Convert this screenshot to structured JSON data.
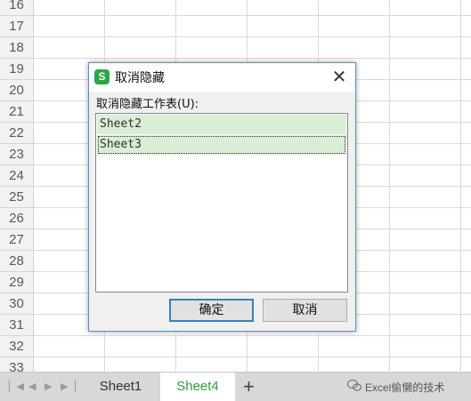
{
  "rows": [
    "16",
    "17",
    "18",
    "19",
    "20",
    "21",
    "22",
    "23",
    "24",
    "25",
    "26",
    "27",
    "28",
    "29",
    "30",
    "31",
    "32",
    "33"
  ],
  "dialog": {
    "app_icon": "S",
    "title": "取消隐藏",
    "close_glyph": "✕",
    "prompt": "取消隐藏工作表(U):",
    "items": [
      "Sheet2",
      "Sheet3"
    ],
    "ok_label": "确定",
    "cancel_label": "取消"
  },
  "tabs": {
    "nav_icons": [
      "first-sheet-icon",
      "prev-sheet-icon",
      "next-sheet-icon",
      "last-sheet-icon"
    ],
    "sheets": [
      "Sheet1",
      "Sheet4"
    ],
    "active": "Sheet4",
    "add_glyph": "+"
  },
  "watermark": "Excel偷懒的技术",
  "colors": {
    "accent_green": "#2aa745",
    "active_tab_text": "#2f9e3c",
    "selection": "#daedd5",
    "dialog_border": "#5b8ec9"
  }
}
